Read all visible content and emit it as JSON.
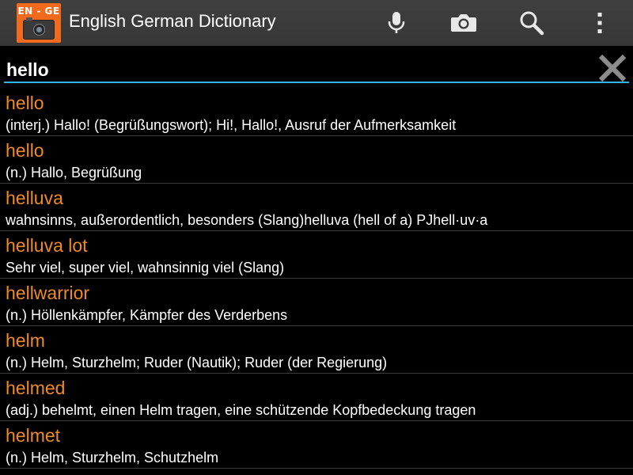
{
  "actionbar": {
    "logo_text": "EN - GE",
    "title": "English German Dictionary",
    "icons": [
      "microphone-icon",
      "camera-icon",
      "search-icon",
      "overflow-menu-icon"
    ]
  },
  "search": {
    "value": "hello",
    "clear_icon": "close-icon"
  },
  "colors": {
    "accent": "#33b5e5",
    "word": "#f08a24",
    "logo_bg": "#f26a1b"
  },
  "results": [
    {
      "word": "hello",
      "definition": "(interj.) Hallo! (Begrüßungswort); Hi!, Hallo!, Ausruf der Aufmerksamkeit"
    },
    {
      "word": "hello",
      "definition": "(n.) Hallo, Begrüßung"
    },
    {
      "word": "helluva",
      "definition": "wahnsinns, außerordentlich, besonders (Slang)helluva (hell of a) PJhell·uv·a"
    },
    {
      "word": "helluva lot",
      "definition": "Sehr viel, super viel, wahnsinnig viel (Slang)"
    },
    {
      "word": "hellwarrior",
      "definition": "(n.) Höllenkämpfer, Kämpfer des Verderbens"
    },
    {
      "word": "helm",
      "definition": "(n.) Helm, Sturzhelm; Ruder (Nautik); Ruder (der Regierung)"
    },
    {
      "word": "helmed",
      "definition": "(adj.) behelmt, einen Helm tragen, eine schützende Kopfbedeckung tragen"
    },
    {
      "word": "helmet",
      "definition": "(n.) Helm, Sturzhelm, Schutzhelm"
    }
  ]
}
